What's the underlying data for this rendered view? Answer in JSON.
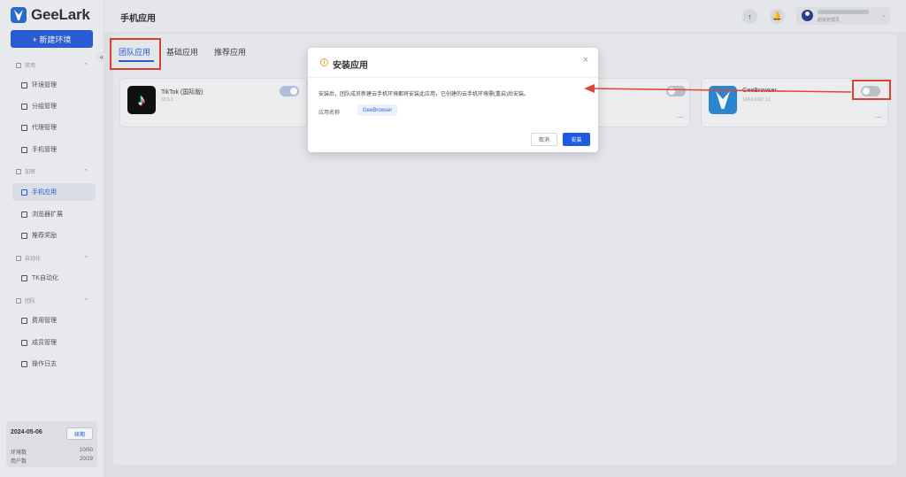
{
  "sidebar": {
    "logo": "GeeLark",
    "new_env": "+ 新建环境",
    "collapse": "«",
    "groups": [
      {
        "label": "常用"
      },
      {
        "label": "加密"
      },
      {
        "label": "自动化"
      },
      {
        "label": "团队"
      }
    ],
    "items": [
      {
        "label": "环境管理"
      },
      {
        "label": "分组管理"
      },
      {
        "label": "代理管理"
      },
      {
        "label": "手机管理"
      },
      {
        "label": "手机应用"
      },
      {
        "label": "浏览器扩展"
      },
      {
        "label": "推荐奖励"
      },
      {
        "label": "TK自动化"
      },
      {
        "label": "费用管理"
      },
      {
        "label": "成员管理"
      },
      {
        "label": "操作日志"
      }
    ],
    "bottom": {
      "date": "2024-05-06",
      "button": "续期",
      "env_label": "环境数",
      "env_value": "10/50",
      "user_label": "用户数",
      "user_value": "20/29"
    }
  },
  "header": {
    "title": "手机应用",
    "user_role": "超级管理员"
  },
  "tabs": [
    "团队应用",
    "基础应用",
    "推荐应用"
  ],
  "apps": [
    {
      "name": "TikTok (国际版)",
      "version": "32.5.1"
    },
    {
      "name": "GeeBrowser",
      "version": "124.0.6367.11"
    }
  ],
  "modal": {
    "title": "安装应用",
    "description": "安装后，团队成员新建云手机环境都将安装此应用，已创建的云手机环境需(重启)后安装。",
    "field_label": "应用名称",
    "field_value": "GeeBrowser",
    "cancel": "取消",
    "confirm": "安装",
    "close": "×"
  },
  "colors": {
    "accent": "#2b5fdc",
    "highlight": "#e0453a"
  }
}
